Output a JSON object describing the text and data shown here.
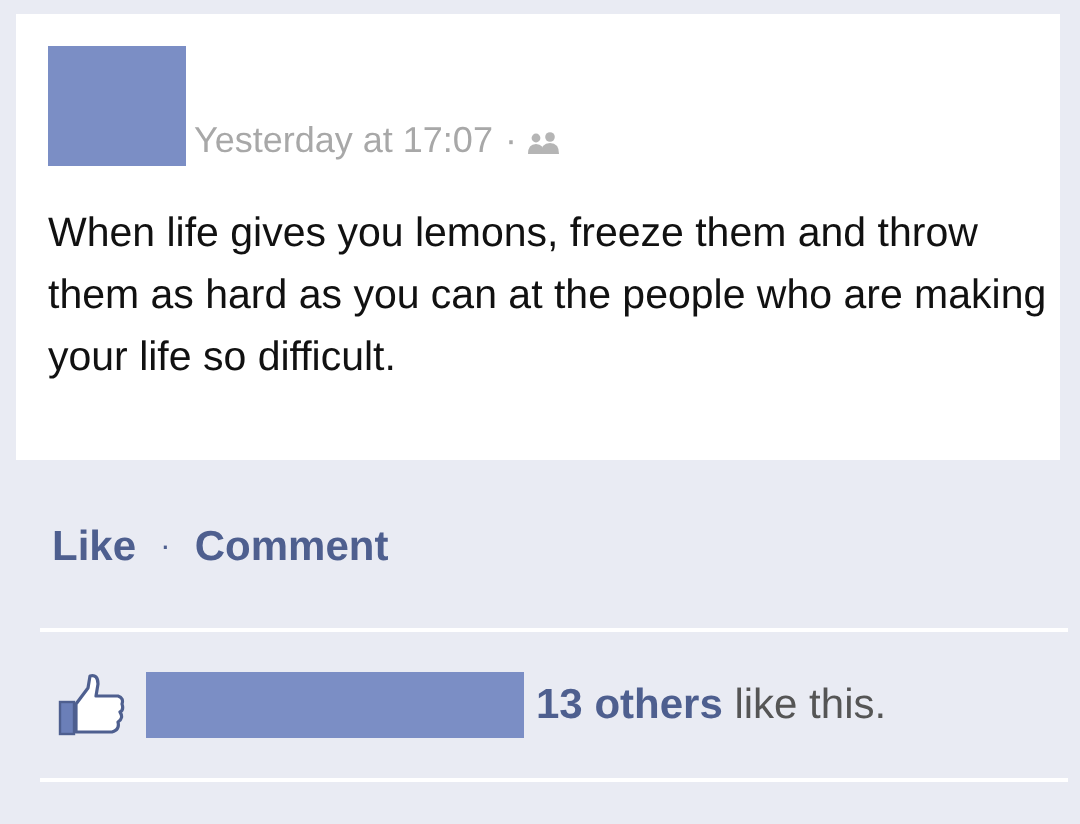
{
  "post": {
    "timestamp": "Yesterday at 17:07",
    "separator": "·",
    "text": "When life gives you lemons, freeze them and throw them as hard as you can at the people who are making your life so difficult."
  },
  "actions": [
    {
      "label": "Like"
    },
    {
      "label": "Comment"
    }
  ],
  "action_separator": "·",
  "likes": {
    "text": "**13 others** like this."
  }
}
